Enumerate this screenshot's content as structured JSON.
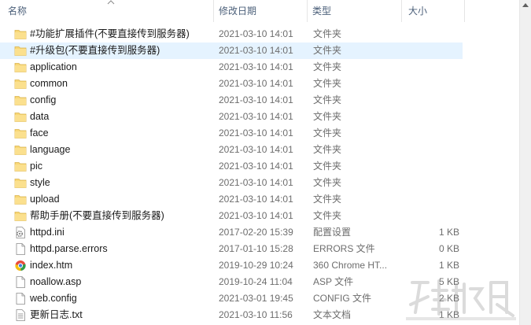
{
  "columns": {
    "name": "名称",
    "date": "修改日期",
    "type": "类型",
    "size": "大小"
  },
  "files": [
    {
      "name": "#功能扩展插件(不要直接传到服务器)",
      "date": "2021-03-10 14:01",
      "type": "文件夹",
      "size": "",
      "icon": "folder-icon"
    },
    {
      "name": "#升级包(不要直接传到服务器)",
      "date": "2021-03-10 14:01",
      "type": "文件夹",
      "size": "",
      "icon": "folder-icon",
      "selected": true
    },
    {
      "name": "application",
      "date": "2021-03-10 14:01",
      "type": "文件夹",
      "size": "",
      "icon": "folder-icon"
    },
    {
      "name": "common",
      "date": "2021-03-10 14:01",
      "type": "文件夹",
      "size": "",
      "icon": "folder-icon"
    },
    {
      "name": "config",
      "date": "2021-03-10 14:01",
      "type": "文件夹",
      "size": "",
      "icon": "folder-icon"
    },
    {
      "name": "data",
      "date": "2021-03-10 14:01",
      "type": "文件夹",
      "size": "",
      "icon": "folder-icon"
    },
    {
      "name": "face",
      "date": "2021-03-10 14:01",
      "type": "文件夹",
      "size": "",
      "icon": "folder-icon"
    },
    {
      "name": "language",
      "date": "2021-03-10 14:01",
      "type": "文件夹",
      "size": "",
      "icon": "folder-icon"
    },
    {
      "name": "pic",
      "date": "2021-03-10 14:01",
      "type": "文件夹",
      "size": "",
      "icon": "folder-icon"
    },
    {
      "name": "style",
      "date": "2021-03-10 14:01",
      "type": "文件夹",
      "size": "",
      "icon": "folder-icon"
    },
    {
      "name": "upload",
      "date": "2021-03-10 14:01",
      "type": "文件夹",
      "size": "",
      "icon": "folder-icon"
    },
    {
      "name": "帮助手册(不要直接传到服务器)",
      "date": "2021-03-10 14:01",
      "type": "文件夹",
      "size": "",
      "icon": "folder-icon"
    },
    {
      "name": "httpd.ini",
      "date": "2017-02-20 15:39",
      "type": "配置设置",
      "size": "1 KB",
      "icon": "settings-file-icon"
    },
    {
      "name": "httpd.parse.errors",
      "date": "2017-01-10 15:28",
      "type": "ERRORS 文件",
      "size": "0 KB",
      "icon": "blank-file-icon"
    },
    {
      "name": "index.htm",
      "date": "2019-10-29 10:24",
      "type": "360 Chrome HT...",
      "size": "1 KB",
      "icon": "browser-file-icon"
    },
    {
      "name": "noallow.asp",
      "date": "2019-10-24 11:04",
      "type": "ASP 文件",
      "size": "5 KB",
      "icon": "blank-file-icon"
    },
    {
      "name": "web.config",
      "date": "2021-03-01 19:45",
      "type": "CONFIG 文件",
      "size": "2 KB",
      "icon": "blank-file-icon"
    },
    {
      "name": "更新日志.txt",
      "date": "2021-03-10 11:56",
      "type": "文本文档",
      "size": "1 KB",
      "icon": "text-file-icon"
    }
  ],
  "colors": {
    "selected_row": "#e5f3ff",
    "folder": "#f8d775",
    "header_text": "#4c607a"
  }
}
